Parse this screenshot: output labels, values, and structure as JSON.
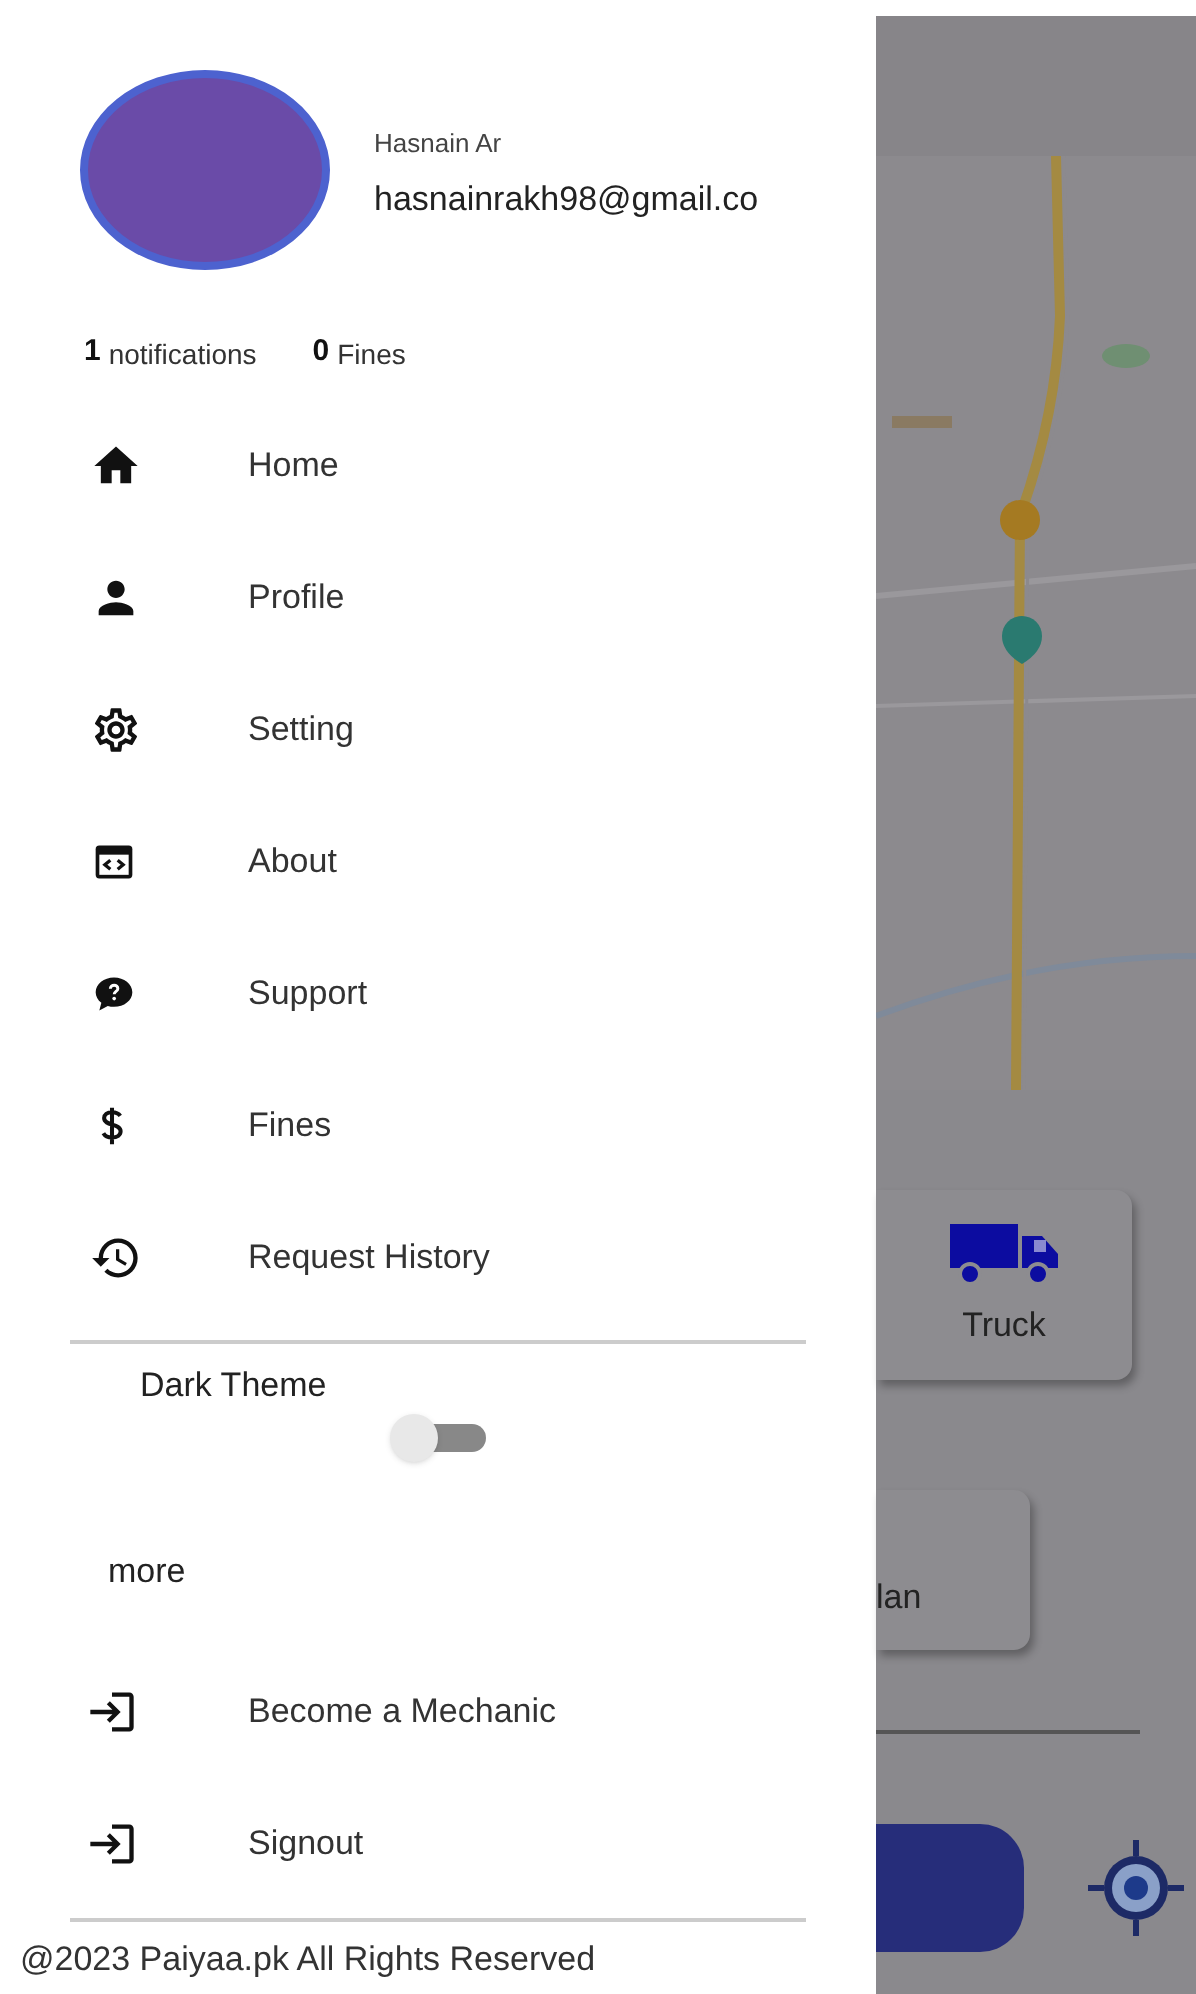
{
  "profile": {
    "name": "Hasnain Ar",
    "email": "hasnainrakh98@gmail.co"
  },
  "counts": [
    {
      "value": "1",
      "label": "notifications"
    },
    {
      "value": "0",
      "label": "Fines"
    }
  ],
  "menu": [
    "Home",
    "Profile",
    "Setting",
    "About",
    "Support",
    "Fines",
    "Request History"
  ],
  "dark_theme": {
    "label": "Dark Theme",
    "on": false
  },
  "more": {
    "title": "more",
    "items": [
      "Become a Mechanic",
      "Signout"
    ]
  },
  "footer": "@2023 Paiyaa.pk All Rights Reserved",
  "background": {
    "cards": [
      {
        "label": "Truck",
        "kind": "truck"
      },
      {
        "label": "lan",
        "kind": "plain"
      }
    ]
  }
}
